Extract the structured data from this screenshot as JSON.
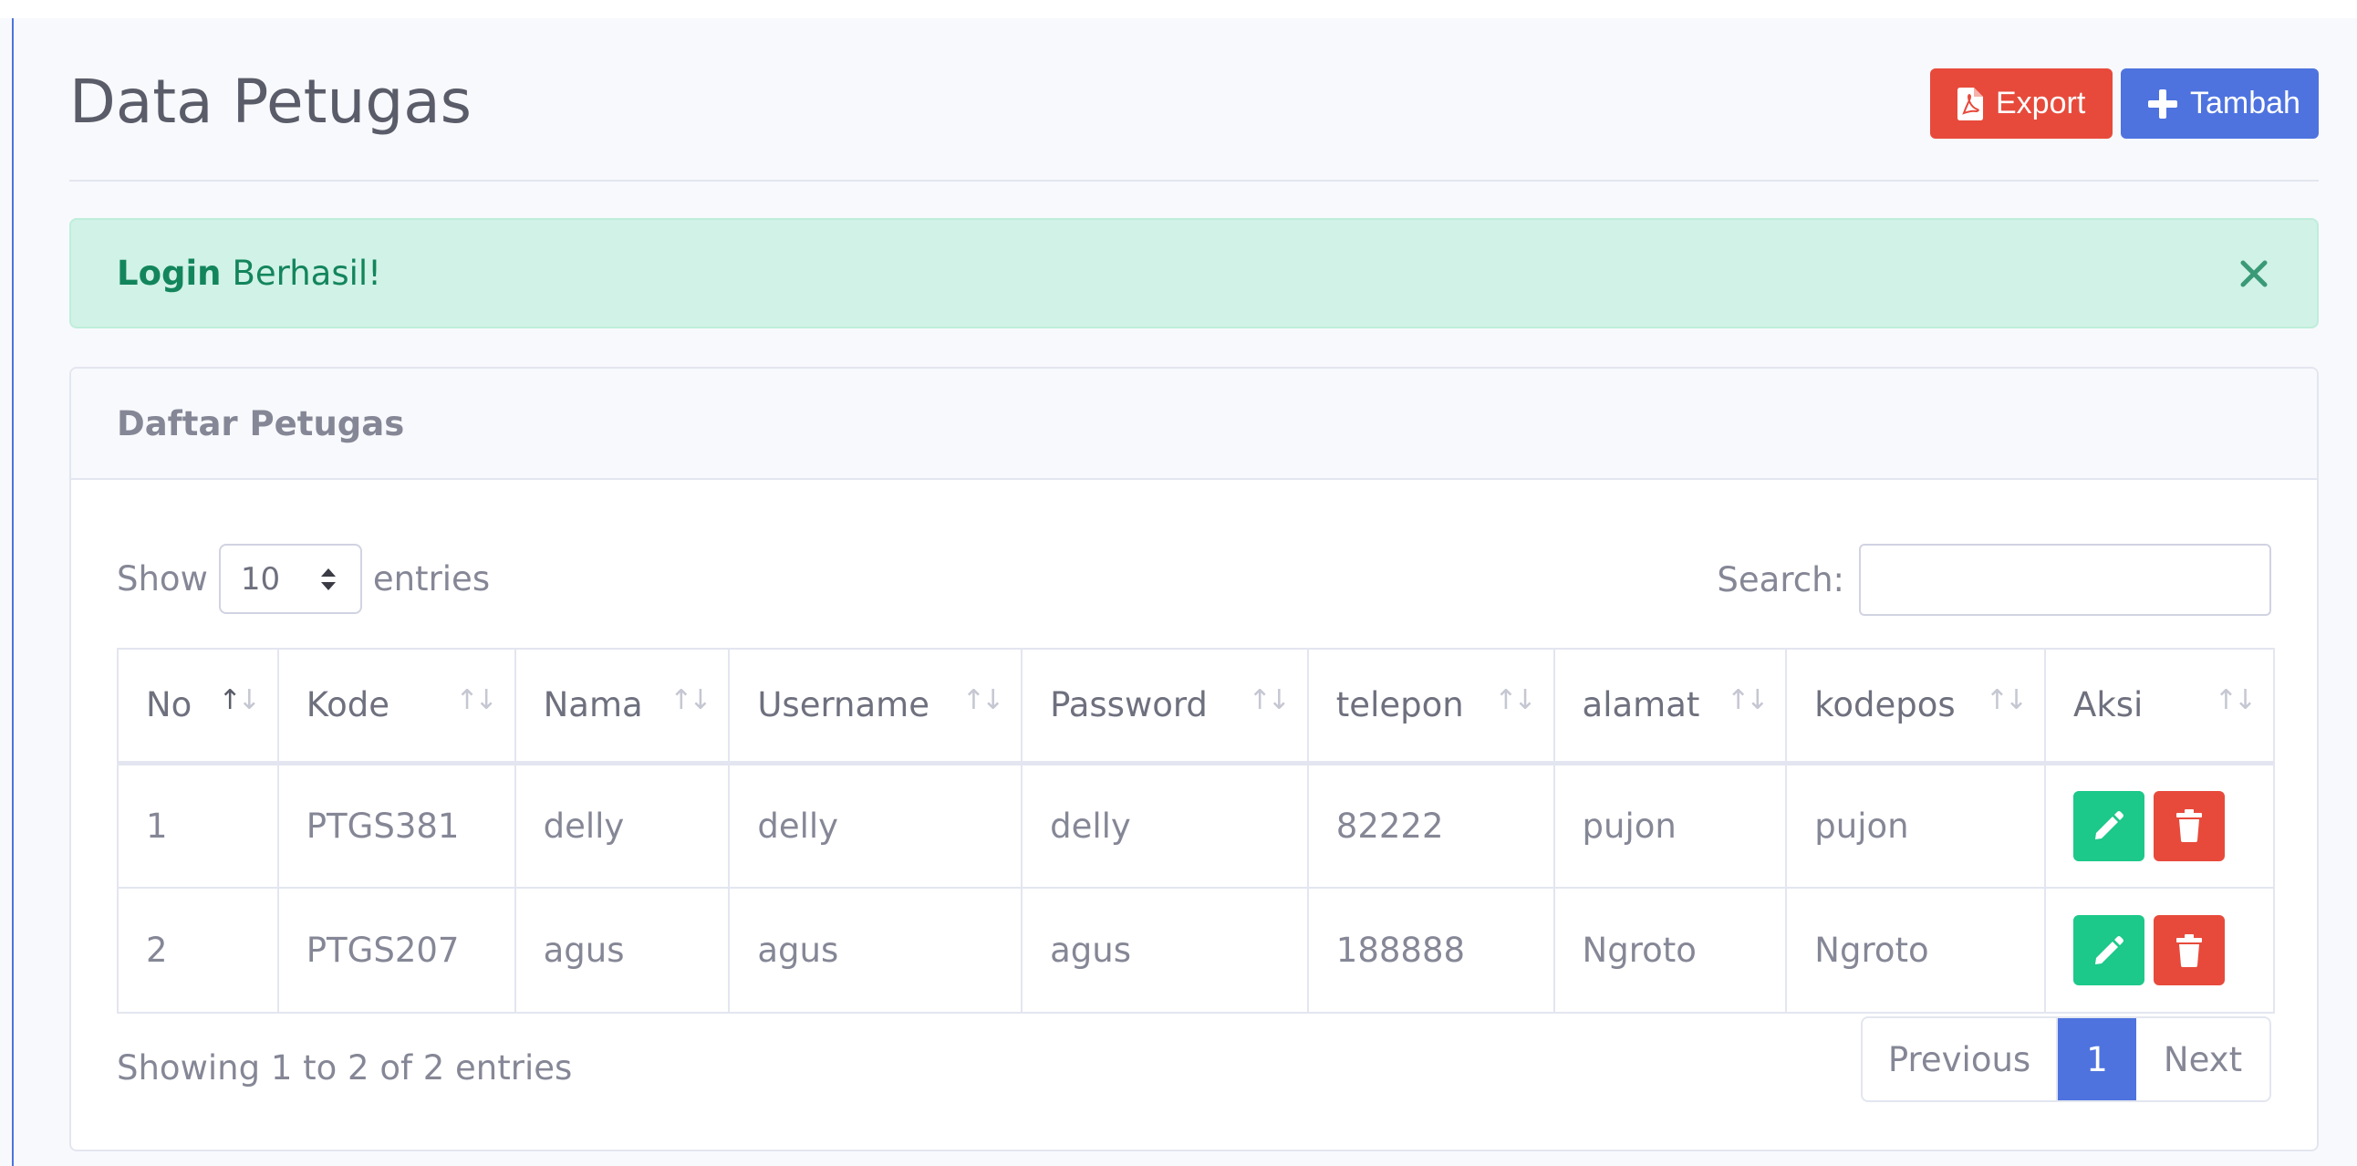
{
  "header": {
    "title": "Data Petugas",
    "export_label": "Export",
    "tambah_label": "Tambah"
  },
  "alert": {
    "strong": "Login",
    "message": "Berhasil!"
  },
  "card": {
    "title": "Daftar Petugas"
  },
  "controls": {
    "show_label": "Show",
    "entries_value": "10",
    "entries_label": "entries",
    "search_label": "Search:",
    "search_value": ""
  },
  "table": {
    "columns": [
      "No",
      "Kode",
      "Nama",
      "Username",
      "Password",
      "telepon",
      "alamat",
      "kodepos",
      "Aksi"
    ],
    "rows": [
      [
        "1",
        "PTGS381",
        "delly",
        "delly",
        "delly",
        "82222",
        "pujon",
        "pujon"
      ],
      [
        "2",
        "PTGS207",
        "agus",
        "agus",
        "agus",
        "188888",
        "Ngroto",
        "Ngroto"
      ]
    ]
  },
  "footer": {
    "info": "Showing 1 to 2 of 2 entries",
    "previous": "Previous",
    "page": "1",
    "next": "Next"
  },
  "icons": {
    "export": "file-pdf-icon",
    "tambah": "plus-icon",
    "close": "close-icon",
    "sort": "sort-icon",
    "edit": "pencil-icon",
    "delete": "trash-icon",
    "select": "select-arrows-icon"
  },
  "colors": {
    "primary": "#4e73df",
    "danger": "#e74a3b",
    "success": "#1cc88a",
    "alert_bg": "#d1f2e7",
    "alert_text": "#13855c"
  }
}
